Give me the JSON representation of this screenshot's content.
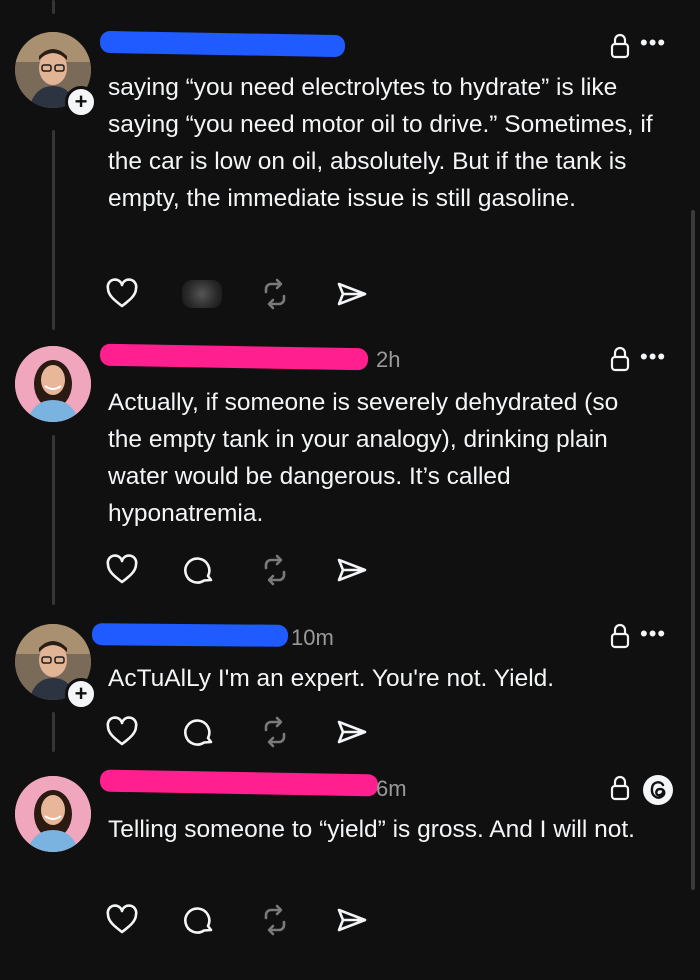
{
  "posts": [
    {
      "author_avatar": "man-with-glasses-avatar",
      "time": "",
      "body": "saying “you need electrolytes to hydrate” is like saying “you need motor oil to drive.” Sometimes, if the car is low on oil, absolutely. But if the tank is empty, the immediate issue is still gasoline.",
      "name_redaction_color": "#1f5bff",
      "reply_count_hidden": true
    },
    {
      "author_avatar": "woman-avatar",
      "time": "2h",
      "body": "Actually, if someone is severely dehydrated (so the empty tank in your analogy), drinking plain water would be dangerous. It’s called hyponatremia.",
      "name_redaction_color": "#ff1f8f"
    },
    {
      "author_avatar": "man-with-glasses-avatar",
      "time": "10m",
      "body": "AcTuAlLy I'm an expert. You're not. Yield.",
      "name_redaction_color": "#1f5bff"
    },
    {
      "author_avatar": "woman-avatar",
      "time": "6m",
      "body": "Telling someone to “yield” is gross. And I will not.",
      "name_redaction_color": "#ff1f8f"
    }
  ],
  "icons": {
    "like": "heart-icon",
    "reply": "comment-icon",
    "repost": "repost-icon",
    "share": "send-icon",
    "lock": "lock-icon",
    "more": "more-icon",
    "threads": "threads-logo-icon"
  }
}
